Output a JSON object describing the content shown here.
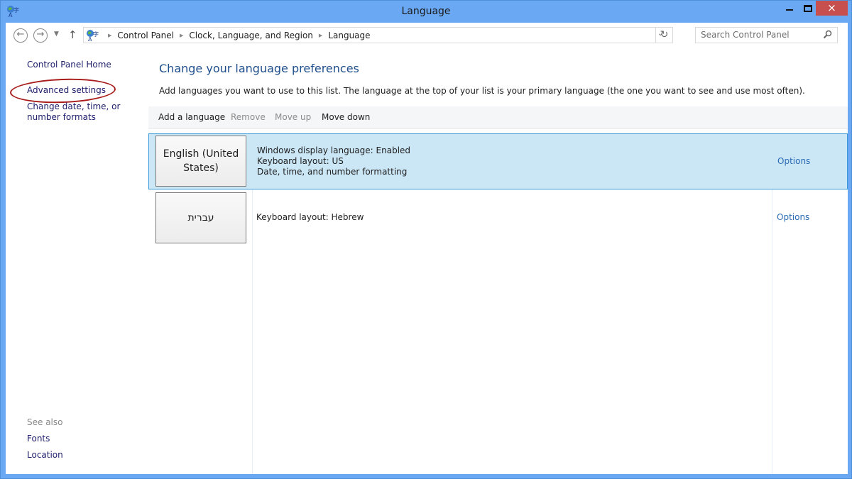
{
  "window": {
    "title": "Language",
    "close_glyph": "×"
  },
  "nav": {
    "back_glyph": "←",
    "forward_glyph": "→",
    "recent_glyph": "▼",
    "up_glyph": "↑",
    "breadcrumbs": [
      "Control Panel",
      "Clock, Language, and Region",
      "Language"
    ],
    "crumb_separator": "▶",
    "dropdown_glyph": "⌄",
    "refresh_glyph": "↻",
    "search_placeholder": "Search Control Panel"
  },
  "sidebar": {
    "home": "Control Panel Home",
    "advanced": "Advanced settings",
    "change_formats": "Change date, time, or number formats",
    "see_also_label": "See also",
    "see_also": [
      "Fonts",
      "Location"
    ]
  },
  "main": {
    "title": "Change your language preferences",
    "description": "Add languages you want to use to this list. The language at the top of your list is your primary language (the one you want to see and use most often).",
    "toolbar": {
      "add": "Add a language",
      "remove": "Remove",
      "move_up": "Move up",
      "move_down": "Move down"
    },
    "languages": [
      {
        "name": "English (United States)",
        "details": [
          "Windows display language: Enabled",
          "Keyboard layout: US",
          "Date, time, and number formatting"
        ],
        "options": "Options",
        "selected": true
      },
      {
        "name": "עברית",
        "details": [
          "Keyboard layout: Hebrew"
        ],
        "options": "Options",
        "selected": false
      }
    ]
  },
  "colors": {
    "title_bar": "#6aa8f3",
    "close_button": "#c7504f",
    "heading": "#1e4e8c",
    "link": "#2a6bb5",
    "selected_row": "#cbe6f5",
    "selected_border": "#3c9bd6",
    "annotation": "#a81c1c"
  }
}
